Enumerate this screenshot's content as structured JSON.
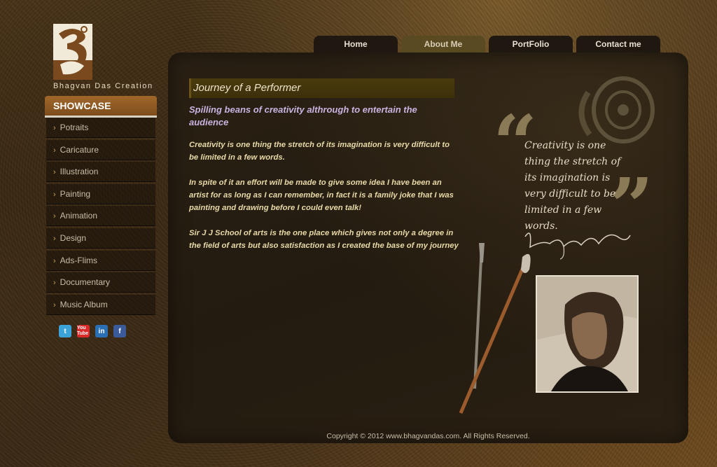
{
  "logo": {
    "text": "Bhagvan Das Creation"
  },
  "nav": {
    "tabs": [
      {
        "label": "Home",
        "active": false
      },
      {
        "label": "About Me",
        "active": true
      },
      {
        "label": "PortFolio",
        "active": false
      },
      {
        "label": "Contact me",
        "active": false
      }
    ]
  },
  "sidebar": {
    "heading": "SHOWCASE",
    "items": [
      {
        "label": "Potraits"
      },
      {
        "label": "Caricature"
      },
      {
        "label": "Illustration"
      },
      {
        "label": "Painting"
      },
      {
        "label": "Animation"
      },
      {
        "label": "Design"
      },
      {
        "label": "Ads-Flims"
      },
      {
        "label": "Documentary"
      },
      {
        "label": "Music Album"
      }
    ],
    "social": [
      {
        "icon": "twitter-icon",
        "glyph": "t"
      },
      {
        "icon": "youtube-icon",
        "glyph": "You Tube"
      },
      {
        "icon": "linkedin-icon",
        "glyph": "in"
      },
      {
        "icon": "facebook-icon",
        "glyph": "f"
      }
    ]
  },
  "main": {
    "title": "Journey of a Performer",
    "subtitle": "Spilling beans of creativity althrough to entertain the audience",
    "paragraphs": [
      "Creativity is one thing the stretch of its imagination is very difficult to be limited in a few words.",
      "In spite of it an effort will be made to give some idea I have been an artist for as long as I can remember, in fact it is a family joke that I was painting and drawing before I could even talk!",
      "Sir J J School of arts is the one place which gives not only a degree in the field of arts but also satisfaction as I created the base of my journey"
    ],
    "quote": "Creativity is one thing the stretch of its imagination is very difficult to be limited in a few words."
  },
  "footer": {
    "copyright": "Copyright © 2012 www.bhagvandas.com. All Rights Reserved."
  },
  "colors": {
    "accent": "#a0672a",
    "subtitle": "#c9b3e0",
    "body_text": "#e8d9a8",
    "tab_bg": "#1e1810",
    "tab_active_bg": "#5a4a22"
  }
}
